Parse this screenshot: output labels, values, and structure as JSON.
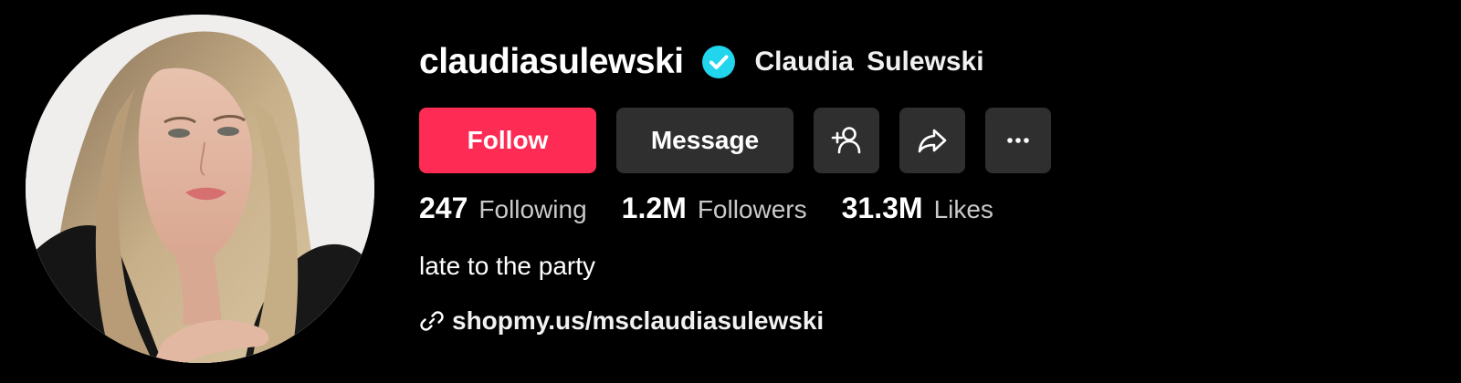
{
  "profile": {
    "username": "claudiasulewski",
    "display_name": "Claudia  Sulewski",
    "verified_icon": "verified-badge-icon",
    "avatar": "profile-photo"
  },
  "actions": {
    "follow_label": "Follow",
    "message_label": "Message",
    "add_friend_icon": "add-user-icon",
    "share_icon": "share-icon",
    "more_icon": "more-icon"
  },
  "stats": [
    {
      "value": "247",
      "label": "Following"
    },
    {
      "value": "1.2M",
      "label": "Followers"
    },
    {
      "value": "31.3M",
      "label": "Likes"
    }
  ],
  "bio": "late to the party",
  "link": {
    "icon": "link-icon",
    "text": "shopmy.us/msclaudiasulewski"
  },
  "colors": {
    "background": "#000000",
    "follow": "#fe2c55",
    "secondary_button": "#2f2f2f",
    "verified": "#20d5ec",
    "muted_text": "#c9c9cb"
  }
}
